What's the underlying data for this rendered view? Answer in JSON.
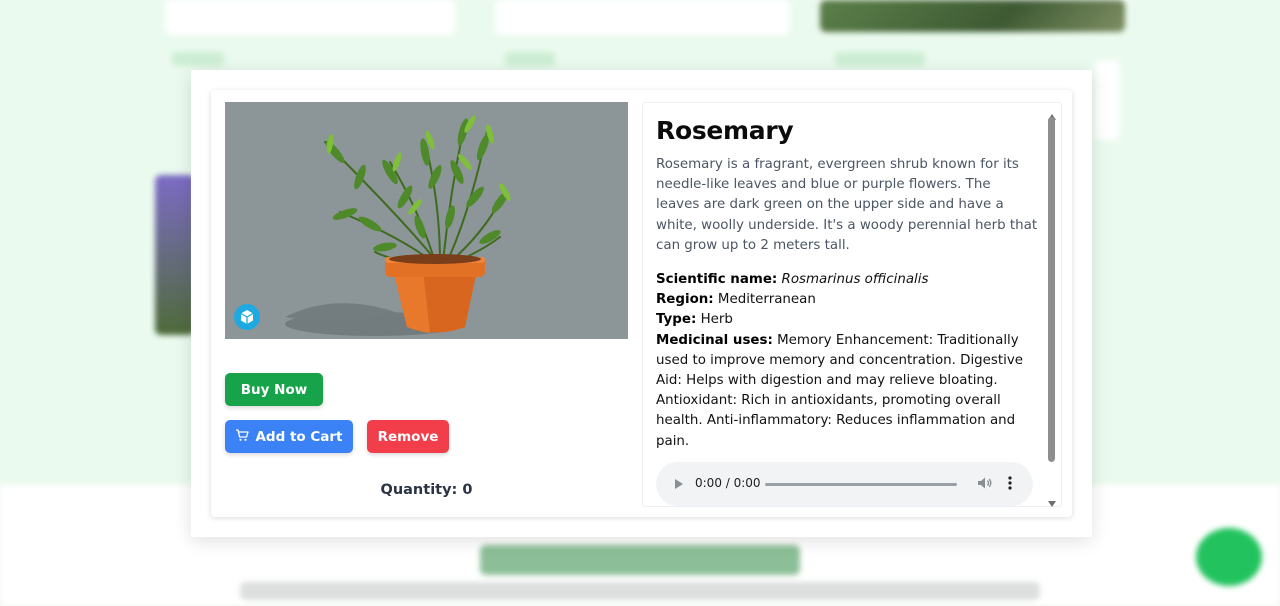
{
  "plant": {
    "name": "Rosemary",
    "description": "Rosemary is a fragrant, evergreen shrub known for its needle-like leaves and blue or purple flowers. The leaves are dark green on the upper side and have a white, woolly underside. It's a woody perennial herb that can grow up to 2 meters tall.",
    "scientific_label": "Scientific name:",
    "scientific_name": "Rosmarinus officinalis",
    "region_label": "Region:",
    "region": "Mediterranean",
    "type_label": "Type:",
    "type": "Herb",
    "medicinal_label": "Medicinal uses:",
    "medicinal_uses": "Memory Enhancement: Traditionally used to improve memory and concentration. Digestive Aid: Helps with digestion and may relieve bloating. Antioxidant: Rich in antioxidants, promoting overall health. Anti-inflammatory: Reduces inflammation and pain."
  },
  "actions": {
    "buy_now": "Buy Now",
    "add_to_cart": "Add to Cart",
    "remove": "Remove"
  },
  "quantity": {
    "text": "Quantity: 0"
  },
  "audio": {
    "time": "0:00 / 0:00",
    "progress": 0
  },
  "colors": {
    "buy_now": "#16a34a",
    "add_to_cart": "#3b82f6",
    "remove": "#f23e4a",
    "viewer_badge": "#1ea9e1"
  },
  "icons": {
    "cart": "cart-icon",
    "viewer": "3d-viewer-icon",
    "play": "play-icon",
    "volume": "volume-icon",
    "more": "more-options-icon"
  }
}
